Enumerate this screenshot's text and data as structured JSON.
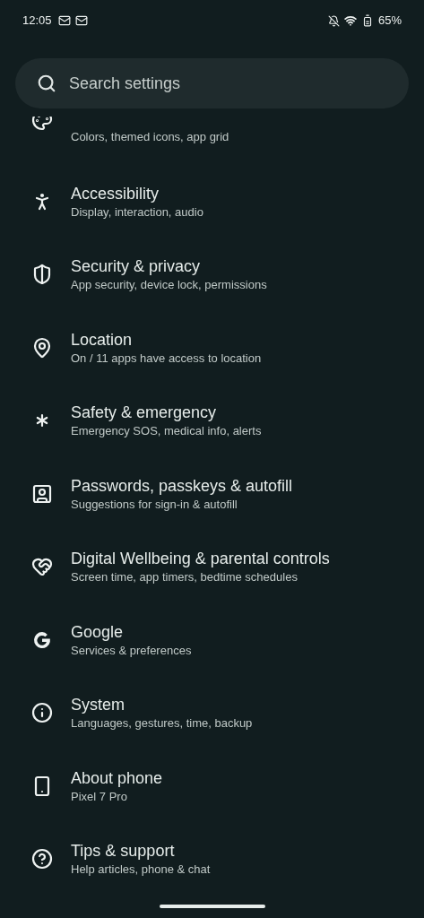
{
  "status_bar": {
    "time": "12:05",
    "battery": "65%"
  },
  "search": {
    "placeholder": "Search settings"
  },
  "items": [
    {
      "kind": "partial",
      "subtitle": "Colors, themed icons, app grid"
    },
    {
      "kind": "full",
      "title": "Accessibility",
      "subtitle": "Display, interaction, audio"
    },
    {
      "kind": "full",
      "title": "Security & privacy",
      "subtitle": "App security, device lock, permissions"
    },
    {
      "kind": "full",
      "title": "Location",
      "subtitle": "On / 11 apps have access to location"
    },
    {
      "kind": "full",
      "title": "Safety & emergency",
      "subtitle": "Emergency SOS, medical info, alerts"
    },
    {
      "kind": "full",
      "title": "Passwords, passkeys & autofill",
      "subtitle": "Suggestions for sign-in & autofill"
    },
    {
      "kind": "full",
      "title": "Digital Wellbeing & parental controls",
      "subtitle": "Screen time, app timers, bedtime schedules"
    },
    {
      "kind": "full",
      "title": "Google",
      "subtitle": "Services & preferences"
    },
    {
      "kind": "full",
      "title": "System",
      "subtitle": "Languages, gestures, time, backup"
    },
    {
      "kind": "full",
      "title": "About phone",
      "subtitle": "Pixel 7 Pro"
    },
    {
      "kind": "full",
      "title": "Tips & support",
      "subtitle": "Help articles, phone & chat"
    }
  ]
}
